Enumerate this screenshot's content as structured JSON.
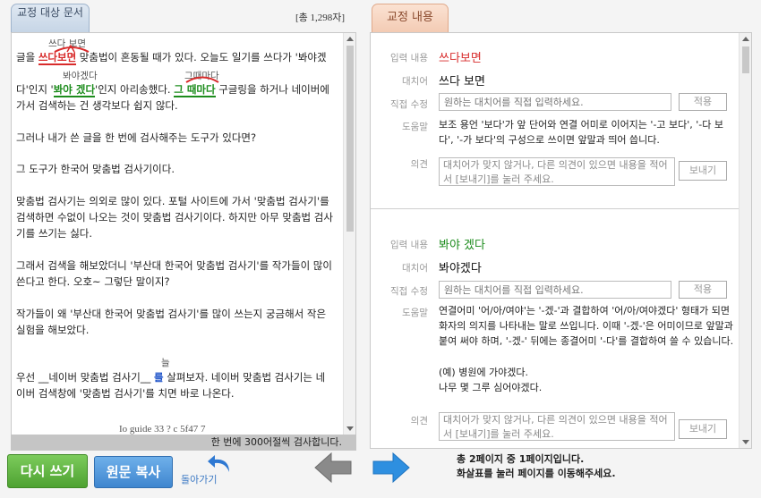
{
  "left": {
    "tab_label": "교정 대상 문서",
    "char_count": "[총 1,298자]",
    "footer_note": "한 번에 300어절씩 검사합니다.",
    "lines": [
      {
        "pre": "글을 ",
        "err": "쓰다보면",
        "post": " 맞춤법이 혼동될 때가 있다. 오늘도 일기를 쓰다가 '봐야겠"
      },
      {
        "pre": "다'인지 '",
        "err": "봐야 겠다",
        "mid": "'인지 아리송했다. ",
        "err2": "그 때마다",
        "post": " 구글링을 하거나 네이버에"
      },
      {
        "text": "가서 검색하는 건 생각보다 쉽지 않다."
      },
      {
        "text": "그러나 내가 쓴 글을 한 번에 검사해주는 도구가 있다면?"
      },
      {
        "text": "그 도구가 한국어 맞춤법 검사기이다."
      },
      {
        "text": "맞춤법 검사기는 의외로 많이 있다. 포털 사이트에 가서 '맞춤법 검사기'를"
      },
      {
        "text": "검색하면 수없이 나오는 것이 맞춤법 검사기이다. 하지만 아무 맞춤법 검사"
      },
      {
        "text": "기를 쓰기는 싫다."
      },
      {
        "text": "그래서 검색을 해보았더니 '부산대 한국어 맞춤법 검사기'를 작가들이 많이"
      },
      {
        "text": "쓴다고 한다. 오호~ 그렇단 말이지?"
      },
      {
        "text": "작가들이  왜 '부산대 한국어 맞춤법 검사기'를 많이 쓰는지 궁금해서 작은"
      },
      {
        "text": "실험을 해보았다."
      },
      {
        "pre": "우선 __네이버 맞춤법 검사기__ ",
        "err": "를",
        "post": " 살펴보자. 네이버 맞춤법 검사기는 네"
      },
      {
        "text": "이버 검색창에 '맞춤법 검사기'를 치면 바로 나온다."
      }
    ],
    "suggestions": [
      "쓰다 보면",
      "봐야겠다",
      "그때마다",
      "늘"
    ],
    "garbled_footer": "Io          guide 33       ?           c  5f47  7"
  },
  "right": {
    "tab_label": "교정 내용",
    "labels": {
      "input": "입력 내용",
      "suggestion": "대치어",
      "direct": "직접 수정",
      "help": "도움말",
      "opinion": "의견"
    },
    "direct_placeholder": "원하는 대치어를 직접 입력하세요.",
    "apply_label": "적용",
    "opinion_placeholder": "대치어가 맞지 않거나, 다른 의견이 있으면 내용을 적어서 [보내기]를 눌러 주세요.",
    "send_label": "보내기",
    "entries": [
      {
        "input": "쓰다보면",
        "suggestion": "쓰다 보면",
        "help": "보조 용언 '보다'가 앞 단어와 연결 어미로 이어지는 '-고 보다', '-다 보다', '-가 보다'의 구성으로 쓰이면 앞말과 띄어 씁니다."
      },
      {
        "input": "봐야 겠다",
        "suggestion": "봐야겠다",
        "help": "연결어미 '어/아/여야'는 '-겠-'과 결합하여 '어/아/여야겠다' 형태가 되면 화자의 의지를 나타내는 말로 쓰입니다. 이때 '-겠-'은 어미이므로 앞말과 붙여 써야 하며, '-겠-' 뒤에는 종결어미 '-다'를 결합하여 쓸 수 있습니다.",
        "example1": "(예) 병원에 가야겠다.",
        "example2": "나무 몇 그루 심어야겠다."
      }
    ]
  },
  "bottom": {
    "rewrite_label": "다시 쓰기",
    "copy_label": "원문 복사",
    "back_label": "돌아가기",
    "page_info_line1": "총 2페이지 중 1페이지입니다.",
    "page_info_line2": "화살표를 눌러 페이지를 이동해주세요."
  },
  "colors": {
    "error_red": "#d82b2b",
    "error_green": "#1c8c1c",
    "error_blue": "#1c52c8",
    "nav_blue": "#2e8fe0",
    "nav_gray": "#8a8a8a"
  },
  "icons": [
    "back-arrow-icon",
    "prev-page-arrow-icon",
    "next-page-arrow-icon"
  ]
}
